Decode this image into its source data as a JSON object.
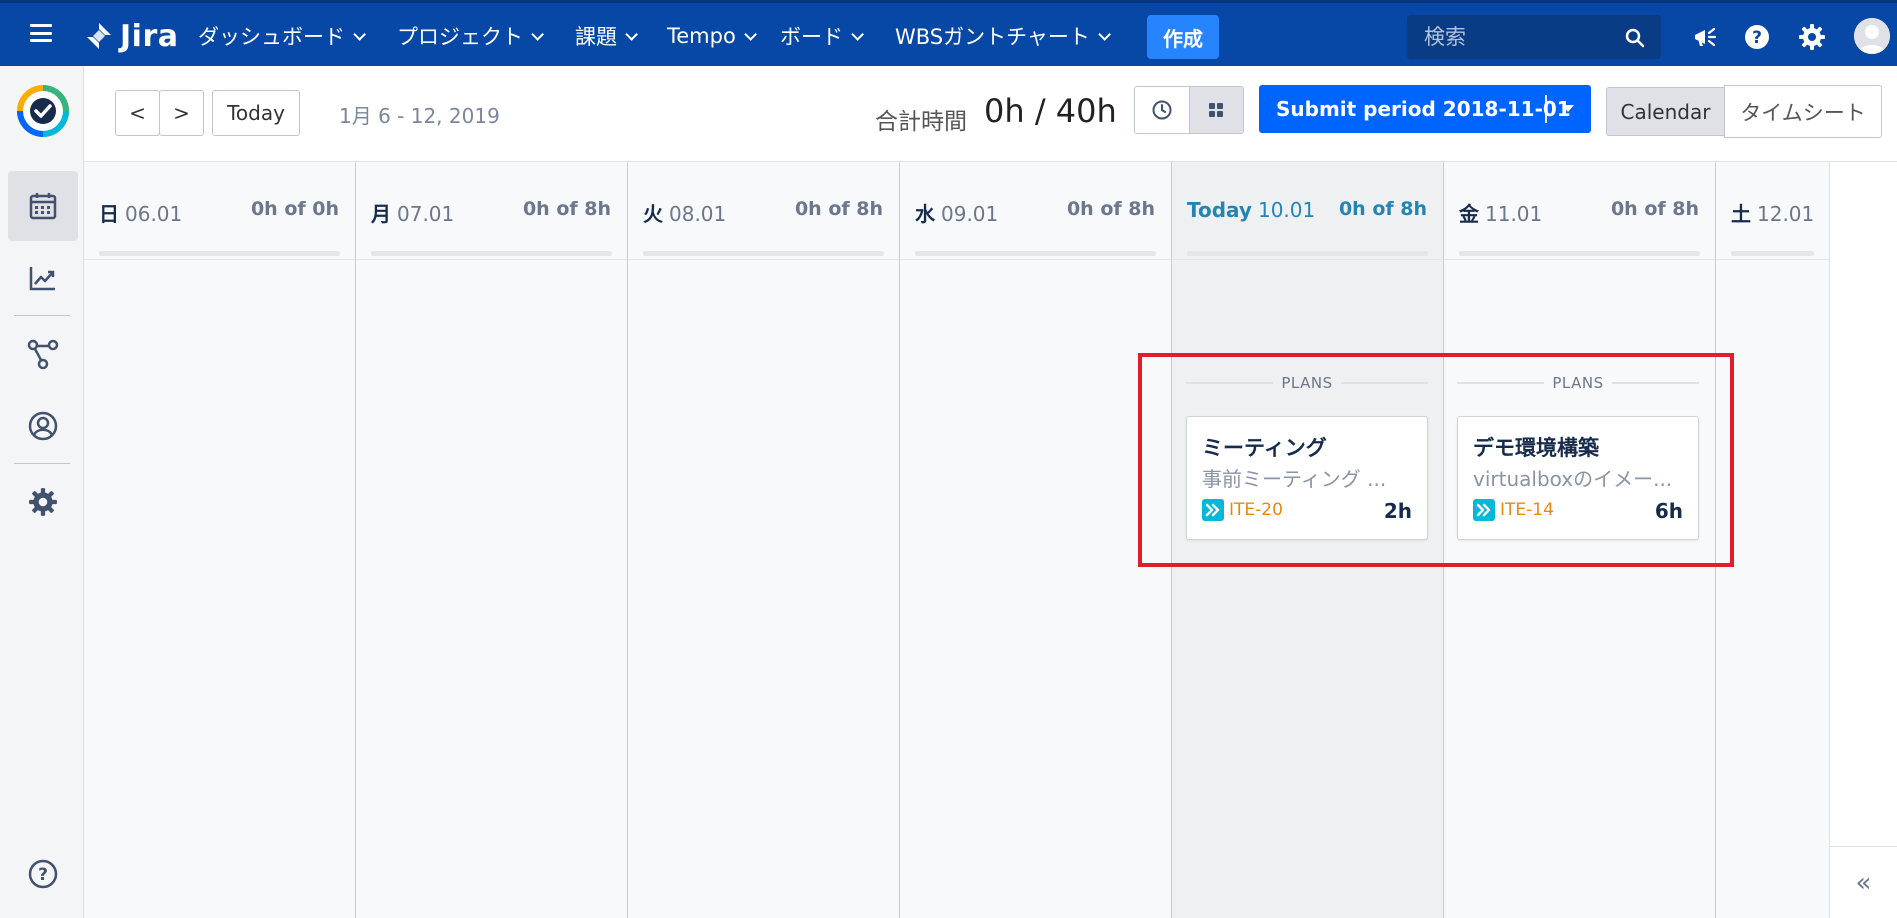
{
  "topbar": {
    "logo_text": "Jira",
    "nav": [
      {
        "label": "ダッシュボード"
      },
      {
        "label": "プロジェクト"
      },
      {
        "label": "課題"
      },
      {
        "label": "Tempo"
      },
      {
        "label": "ボード"
      },
      {
        "label": "WBSガントチャート"
      }
    ],
    "create_label": "作成",
    "search_placeholder": "検索",
    "icons": [
      "menu-icon",
      "jira-logo-icon",
      "search-icon",
      "megaphone-icon",
      "help-icon",
      "settings-icon",
      "user-avatar-icon"
    ],
    "colors": {
      "bar": "#0747a6",
      "create": "#2684ff"
    }
  },
  "sidebar": {
    "items": [
      {
        "name": "tempo-logo-icon"
      },
      {
        "name": "calendar-icon",
        "active": true
      },
      {
        "name": "reports-icon"
      },
      {
        "name": "plans-network-icon"
      },
      {
        "name": "account-icon"
      },
      {
        "name": "settings-icon"
      },
      {
        "name": "help-icon"
      }
    ]
  },
  "toolbar": {
    "prev_label": "<",
    "next_label": ">",
    "today_label": "Today",
    "range": "1月 6 - 12, 2019",
    "total_label": "合計時間",
    "total_value": "0h / 40h",
    "submit_label": "Submit period 2018-11-01",
    "view_calendar": "Calendar",
    "view_timesheet": "タイムシート",
    "active_view_mode": "grid",
    "colors": {
      "submit": "#0065ff"
    }
  },
  "calendar": {
    "today_color": "#2684b3",
    "days": [
      {
        "name": "日",
        "date": "06.01",
        "hours": "0h of 0h"
      },
      {
        "name": "月",
        "date": "07.01",
        "hours": "0h of 8h"
      },
      {
        "name": "火",
        "date": "08.01",
        "hours": "0h of 8h"
      },
      {
        "name": "水",
        "date": "09.01",
        "hours": "0h of 8h"
      },
      {
        "name": "Today",
        "date": "10.01",
        "hours": "0h of 8h",
        "today": true
      },
      {
        "name": "金",
        "date": "11.01",
        "hours": "0h of 8h"
      },
      {
        "name": "土",
        "date": "12.01",
        "hours": ""
      }
    ],
    "plans": [
      {
        "section_label": "PLANS",
        "title": "ミーティング",
        "description": "事前ミーティング ...",
        "issue": "ITE-20",
        "hours": "2h"
      },
      {
        "section_label": "PLANS",
        "title": "デモ環境構築",
        "description": "virtualboxのイメー...",
        "issue": "ITE-14",
        "hours": "6h"
      }
    ],
    "highlight_color": "#e01f2e",
    "collapse_label": "«"
  }
}
